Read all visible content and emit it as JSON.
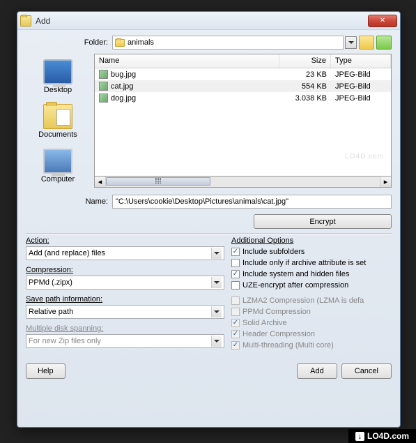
{
  "window": {
    "title": "Add"
  },
  "folder": {
    "label": "Folder:",
    "value": "animals"
  },
  "sidebar": {
    "items": [
      {
        "label": "Desktop"
      },
      {
        "label": "Documents"
      },
      {
        "label": "Computer"
      }
    ]
  },
  "file_list": {
    "headers": {
      "name": "Name",
      "size": "Size",
      "type": "Type"
    },
    "rows": [
      {
        "name": "bug.jpg",
        "size": "23 KB",
        "type": "JPEG-Bild",
        "selected": false
      },
      {
        "name": "cat.jpg",
        "size": "554 KB",
        "type": "JPEG-Bild",
        "selected": true
      },
      {
        "name": "dog.jpg",
        "size": "3.038 KB",
        "type": "JPEG-Bild",
        "selected": false
      }
    ],
    "watermark": "LO4D.com"
  },
  "scrollbar_thumb": "⁞⁞⁞",
  "name_field": {
    "label": "Name:",
    "value": "\"C:\\Users\\cookie\\Desktop\\Pictures\\animals\\cat.jpg\""
  },
  "encrypt_button": "Encrypt",
  "left_options": {
    "action": {
      "label": "Action:",
      "value": "Add (and replace) files"
    },
    "compression": {
      "label": "Compression:",
      "value": "PPMd (.zipx)"
    },
    "save_path": {
      "label": "Save path information:",
      "value": "Relative path"
    },
    "disk_span": {
      "label": "Multiple disk spanning:",
      "value": "For new Zip files only"
    }
  },
  "right_options": {
    "title": "Additional Options",
    "items": [
      {
        "label": "Include subfolders",
        "checked": true,
        "disabled": false
      },
      {
        "label": "Include only if archive attribute is set",
        "checked": false,
        "disabled": false
      },
      {
        "label": "Include system and hidden files",
        "checked": true,
        "disabled": false
      },
      {
        "label": "UZE-encrypt after compression",
        "checked": false,
        "disabled": false
      },
      {
        "label": "LZMA2 Compression (LZMA is defa",
        "checked": false,
        "disabled": true
      },
      {
        "label": "PPMd Compression",
        "checked": false,
        "disabled": true
      },
      {
        "label": "Solid Archive",
        "checked": true,
        "disabled": true
      },
      {
        "label": "Header Compression",
        "checked": true,
        "disabled": true
      },
      {
        "label": "Multi-threading (Multi core)",
        "checked": true,
        "disabled": true
      }
    ]
  },
  "buttons": {
    "help": "Help",
    "add": "Add",
    "cancel": "Cancel"
  },
  "footer": {
    "text": "LO4D.com",
    "arrow": "↓"
  }
}
